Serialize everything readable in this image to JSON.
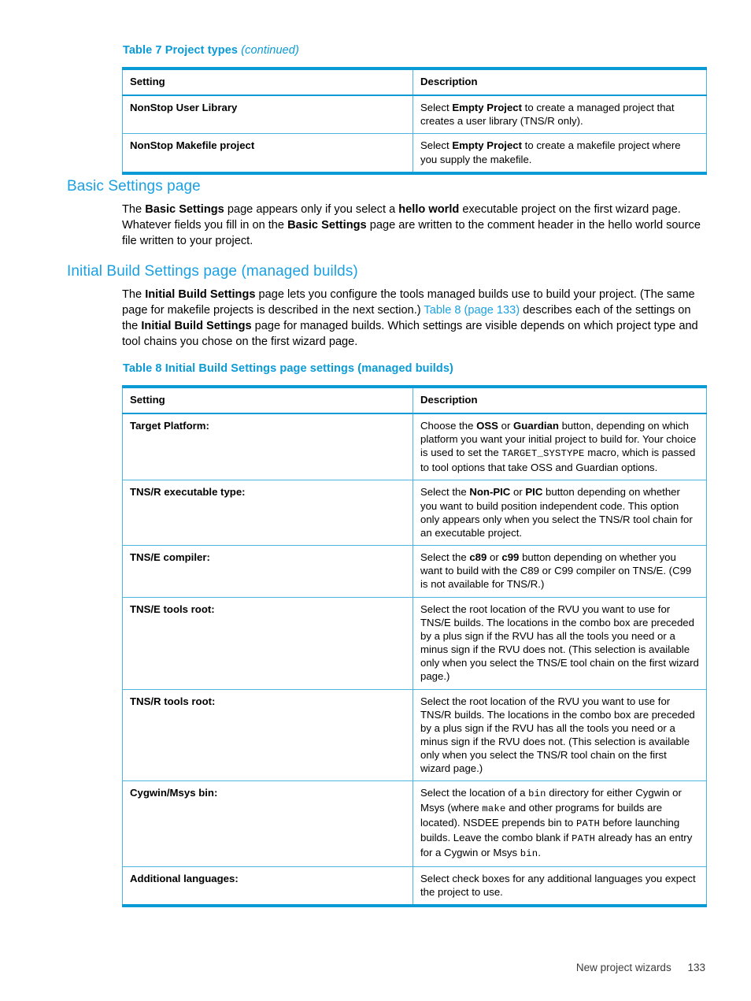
{
  "table7": {
    "caption_main": "Table 7 Project types",
    "caption_continued": "(continued)",
    "columns": [
      "Setting",
      "Description"
    ],
    "rows": [
      {
        "setting": "NonStop User Library",
        "description_parts": [
          {
            "text": "Select ",
            "style": "normal"
          },
          {
            "text": "Empty Project",
            "style": "bold"
          },
          {
            "text": " to create a managed project that creates a user library (TNS/R only).",
            "style": "normal"
          }
        ],
        "description_plain": "Select Empty Project to create a managed project that creates a user library (TNS/R only)."
      },
      {
        "setting": "NonStop Makefile project",
        "description_parts": [
          {
            "text": "Select ",
            "style": "normal"
          },
          {
            "text": "Empty Project",
            "style": "bold"
          },
          {
            "text": " to create a makefile project where you supply the makefile.",
            "style": "normal"
          }
        ],
        "description_plain": "Select Empty Project to create a makefile project where you supply the makefile."
      }
    ]
  },
  "section_basic": {
    "heading": "Basic Settings page",
    "paragraph_plain": "The Basic Settings page appears only if you select a hello world executable project on the first wizard page. Whatever fields you fill in on the Basic Settings page are written to the comment header in the hello world source file written to your project."
  },
  "section_initial": {
    "heading": "Initial Build Settings page (managed builds)",
    "paragraph_plain": "The Initial Build Settings page lets you configure the tools managed builds use to build your project. (The same page for makefile projects is described in the next section.) Table 8 (page 133) describes each of the settings on the Initial Build Settings page for managed builds. Which settings are visible depends on which project type and tool chains you chose on the first wizard page.",
    "cross_reference_link": "Table 8 (page 133)"
  },
  "table8": {
    "caption_main": "Table 8 Initial Build Settings page settings (managed builds)",
    "columns": [
      "Setting",
      "Description"
    ],
    "rows": [
      {
        "setting": "Target Platform:",
        "description_plain": "Choose the OSS or Guardian button, depending on which platform you want your initial project to build for. Your choice is used to set the TARGET_SYSTYPE macro, which is passed to tool options that take OSS and Guardian options."
      },
      {
        "setting": "TNS/R executable type:",
        "description_plain": "Select the Non-PIC or PIC button depending on whether you want to build position independent code. This option only appears only when you select the TNS/R tool chain for an executable project."
      },
      {
        "setting": "TNS/E compiler:",
        "description_plain": "Select the c89 or c99 button depending on whether you want to build with the C89 or C99 compiler on TNS/E. (C99 is not available for TNS/R.)"
      },
      {
        "setting": "TNS/E tools root:",
        "description_plain": "Select the root location of the RVU you want to use for TNS/E builds. The locations in the combo box are preceded by a plus sign if the RVU has all the tools you need or a minus sign if the RVU does not. (This selection is available only when you select the TNS/E tool chain on the first wizard page.)"
      },
      {
        "setting": "TNS/R tools root:",
        "description_plain": "Select the root location of the RVU you want to use for TNS/R builds. The locations in the combo box are preceded by a plus sign if the RVU has all the tools you need or a minus sign if the RVU does not. (This selection is available only when you select the TNS/R tool chain on the first wizard page.)"
      },
      {
        "setting": "Cygwin/Msys bin:",
        "description_plain": "Select the location of a bin directory for either Cygwin or Msys (where make and other programs for builds are located). NSDEE prepends bin to PATH before launching builds. Leave the combo blank if PATH already has an entry for a Cygwin or Msys bin."
      },
      {
        "setting": "Additional languages:",
        "description_plain": "Select check boxes for any additional languages you expect the project to use."
      }
    ]
  },
  "footer": {
    "chapter": "New project wizards",
    "page_number": "133"
  },
  "colors": {
    "heading_blue": "#1ba1e2",
    "caption_blue": "#0a9bd7",
    "table_border_thick": "#0a9bd7",
    "table_border_thin": "#4cb6e0",
    "link_blue": "#1ba1e2",
    "text_black": "#000000"
  }
}
